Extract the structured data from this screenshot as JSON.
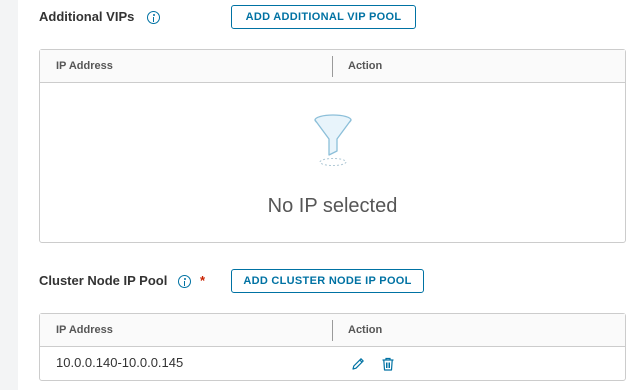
{
  "additional_vips": {
    "label": "Additional VIPs",
    "add_button": "ADD ADDITIONAL VIP POOL",
    "grid": {
      "columns": [
        "IP Address",
        "Action"
      ],
      "empty_message": "No IP selected"
    }
  },
  "cluster_node_ip_pool": {
    "label": "Cluster Node IP Pool",
    "required_marker": "*",
    "add_button": "ADD CLUSTER NODE IP POOL",
    "grid": {
      "columns": [
        "IP Address",
        "Action"
      ],
      "rows": [
        {
          "ip_address": "10.0.0.140-10.0.0.145",
          "actions": [
            "edit-icon",
            "delete-icon"
          ]
        }
      ]
    }
  },
  "colors": {
    "accent": "#0072a3",
    "required": "#c92100",
    "border": "#cccccc",
    "header_bg": "#fafafa"
  }
}
